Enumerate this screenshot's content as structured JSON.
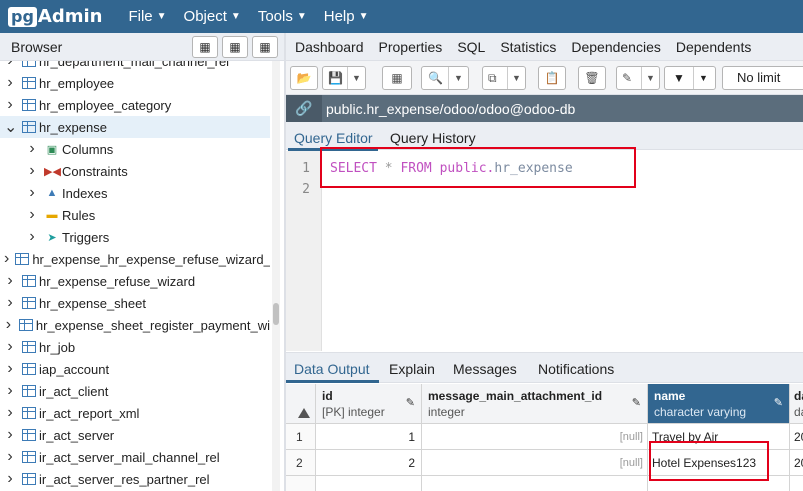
{
  "app": {
    "logo_pg": "pg",
    "logo_admin": "Admin"
  },
  "menu": [
    "File",
    "Object",
    "Tools",
    "Help"
  ],
  "browser": {
    "title": "Browser",
    "tree": [
      {
        "label": "hr_department_mail_channel_rel",
        "level": 0,
        "kind": "table"
      },
      {
        "label": "hr_employee",
        "level": 0,
        "kind": "table"
      },
      {
        "label": "hr_employee_category",
        "level": 0,
        "kind": "table"
      },
      {
        "label": "hr_expense",
        "level": 0,
        "kind": "table",
        "expanded": true,
        "selected": true
      },
      {
        "label": "Columns",
        "level": 1,
        "kind": "columns"
      },
      {
        "label": "Constraints",
        "level": 1,
        "kind": "constraints"
      },
      {
        "label": "Indexes",
        "level": 1,
        "kind": "indexes"
      },
      {
        "label": "Rules",
        "level": 1,
        "kind": "rules"
      },
      {
        "label": "Triggers",
        "level": 1,
        "kind": "triggers"
      },
      {
        "label": "hr_expense_hr_expense_refuse_wizard_",
        "level": 0,
        "kind": "table"
      },
      {
        "label": "hr_expense_refuse_wizard",
        "level": 0,
        "kind": "table"
      },
      {
        "label": "hr_expense_sheet",
        "level": 0,
        "kind": "table"
      },
      {
        "label": "hr_expense_sheet_register_payment_wi",
        "level": 0,
        "kind": "table"
      },
      {
        "label": "hr_job",
        "level": 0,
        "kind": "table"
      },
      {
        "label": "iap_account",
        "level": 0,
        "kind": "table"
      },
      {
        "label": "ir_act_client",
        "level": 0,
        "kind": "table"
      },
      {
        "label": "ir_act_report_xml",
        "level": 0,
        "kind": "table"
      },
      {
        "label": "ir_act_server",
        "level": 0,
        "kind": "table"
      },
      {
        "label": "ir_act_server_mail_channel_rel",
        "level": 0,
        "kind": "table"
      },
      {
        "label": "ir_act_server_res_partner_rel",
        "level": 0,
        "kind": "table"
      }
    ]
  },
  "main_tabs": [
    "Dashboard",
    "Properties",
    "SQL",
    "Statistics",
    "Dependencies",
    "Dependents"
  ],
  "toolbar": {
    "limit": "No limit"
  },
  "connection": {
    "label": "public.hr_expense/odoo/odoo@odoo-db"
  },
  "query_tabs": [
    "Query Editor",
    "Query History"
  ],
  "editor": {
    "line_numbers": [
      "1",
      "2"
    ],
    "sql": {
      "select": "SELECT",
      "star": " * ",
      "from": "FROM",
      "schema": " public.",
      "table": "hr_expense"
    }
  },
  "result_tabs": [
    "Data Output",
    "Explain",
    "Messages",
    "Notifications"
  ],
  "grid": {
    "columns": [
      {
        "name": "id",
        "type": "[PK] integer"
      },
      {
        "name": "message_main_attachment_id",
        "type": "integer"
      },
      {
        "name": "name",
        "type": "character varying"
      },
      {
        "name": "da",
        "type": "da"
      }
    ],
    "rows": [
      {
        "rownum": "1",
        "id": "1",
        "attachment": "[null]",
        "name": "Travel by Air",
        "date": "20"
      },
      {
        "rownum": "2",
        "id": "2",
        "attachment": "[null]",
        "name": "Hotel Expenses123",
        "date": "20"
      }
    ]
  },
  "colors": {
    "navbar": "#326690",
    "accent": "#326690",
    "highlight": "#e2001a"
  }
}
